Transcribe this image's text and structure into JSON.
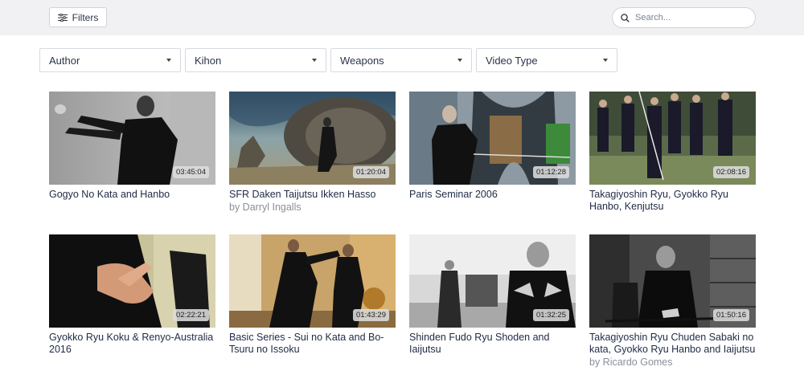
{
  "toolbar": {
    "filters_label": "Filters",
    "search_placeholder": "Search..."
  },
  "filters": [
    {
      "label": "Author"
    },
    {
      "label": "Kihon"
    },
    {
      "label": "Weapons"
    },
    {
      "label": "Video Type"
    }
  ],
  "videos": [
    {
      "title": "Gogyo No Kata and Hanbo",
      "author": "",
      "duration": "03:45:04"
    },
    {
      "title": "SFR Daken Taijutsu Ikken Hasso",
      "author": "by Darryl Ingalls",
      "duration": "01:20:04"
    },
    {
      "title": "Paris Seminar 2006",
      "author": "",
      "duration": "01:12:28"
    },
    {
      "title": "Takagiyoshin Ryu, Gyokko Ryu Hanbo, Kenjutsu",
      "author": "",
      "duration": "02:08:16"
    },
    {
      "title": "Gyokko Ryu Koku & Renyo-Australia 2016",
      "author": "",
      "duration": "02:22:21"
    },
    {
      "title": "Basic Series - Sui no Kata and Bo-Tsuru no Issoku",
      "author": "",
      "duration": "01:43:29"
    },
    {
      "title": "Shinden Fudo Ryu Shoden and Iaijutsu",
      "author": "",
      "duration": "01:32:25"
    },
    {
      "title": "Takagiyoshin Ryu Chuden Sabaki no kata, Gyokko Ryu Hanbo and Iaijutsu",
      "author": "by Ricardo Gomes",
      "duration": "01:50:16"
    }
  ]
}
